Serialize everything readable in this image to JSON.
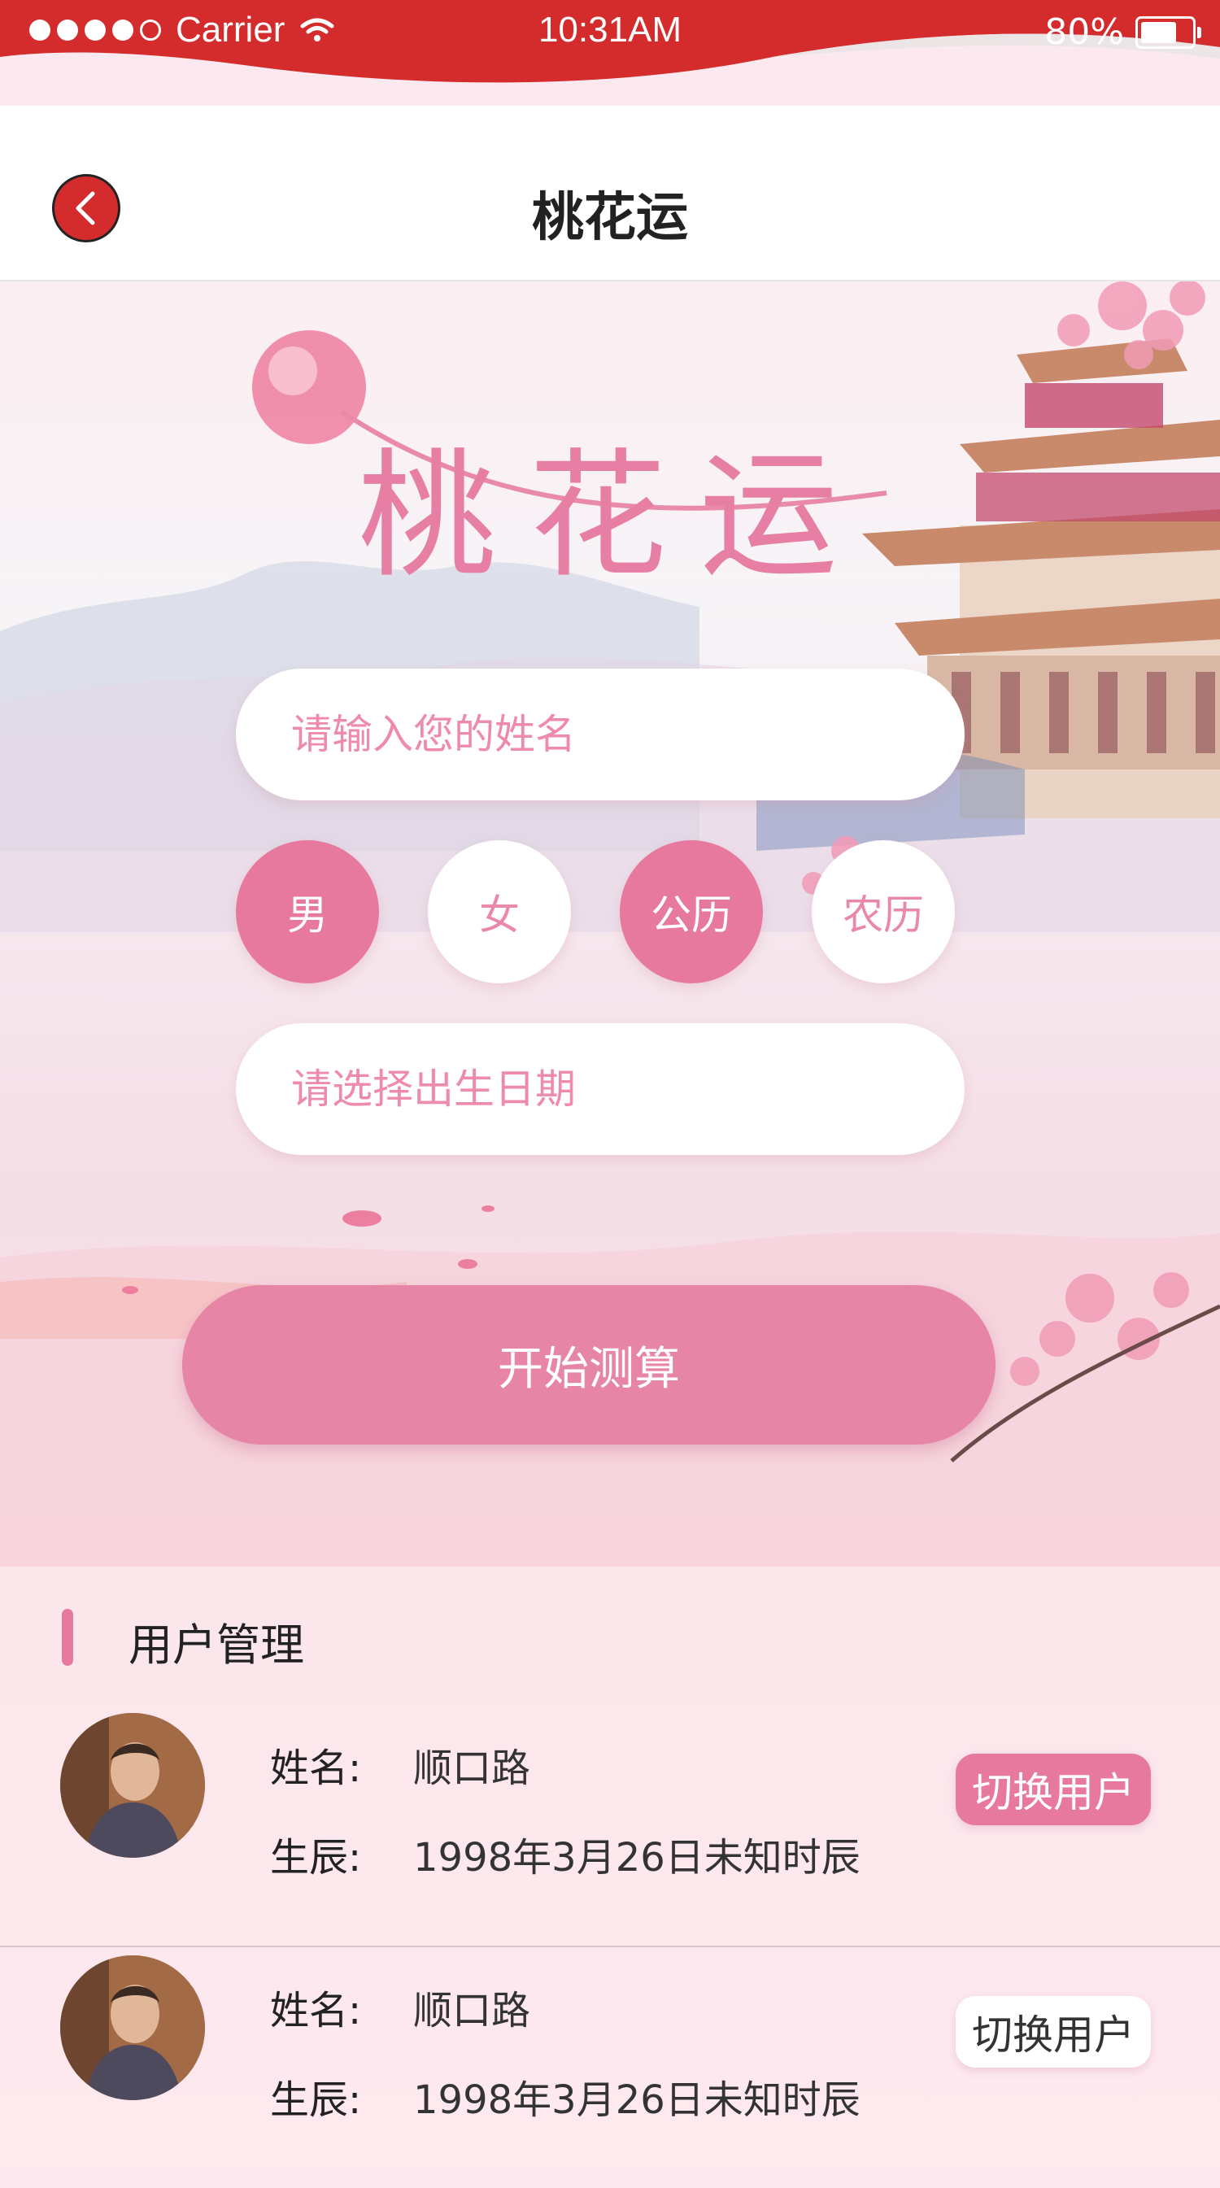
{
  "status_bar": {
    "carrier": "Carrier",
    "time": "10:31AM",
    "battery": "80%",
    "battery_level": 0.8,
    "signal_dots": 5,
    "signal_filled": 4
  },
  "nav": {
    "title": "桃花运",
    "back_icon": "chevron-left-icon"
  },
  "hero": {
    "art_title": "桃花运",
    "name_placeholder": "请输入您的姓名",
    "gender_options": [
      "男",
      "女"
    ],
    "gender_selected": "男",
    "calendar_options": [
      "公历",
      "农历"
    ],
    "calendar_selected": "公历",
    "date_placeholder": "请选择出生日期",
    "start_button": "开始测算"
  },
  "user_management": {
    "title": "用户管理",
    "users": [
      {
        "name_label": "姓名:",
        "name": "顺口路",
        "birth_label": "生辰:",
        "birth": "1998年3月26日未知时辰",
        "switch_label": "切换用户",
        "active": true
      },
      {
        "name_label": "姓名:",
        "name": "顺口路",
        "birth_label": "生辰:",
        "birth": "1998年3月26日未知时辰",
        "switch_label": "切换用户",
        "active": false
      }
    ]
  },
  "colors": {
    "status_red": "#d42c2c",
    "accent_pink": "#e8799e",
    "text_dark": "#222222"
  }
}
